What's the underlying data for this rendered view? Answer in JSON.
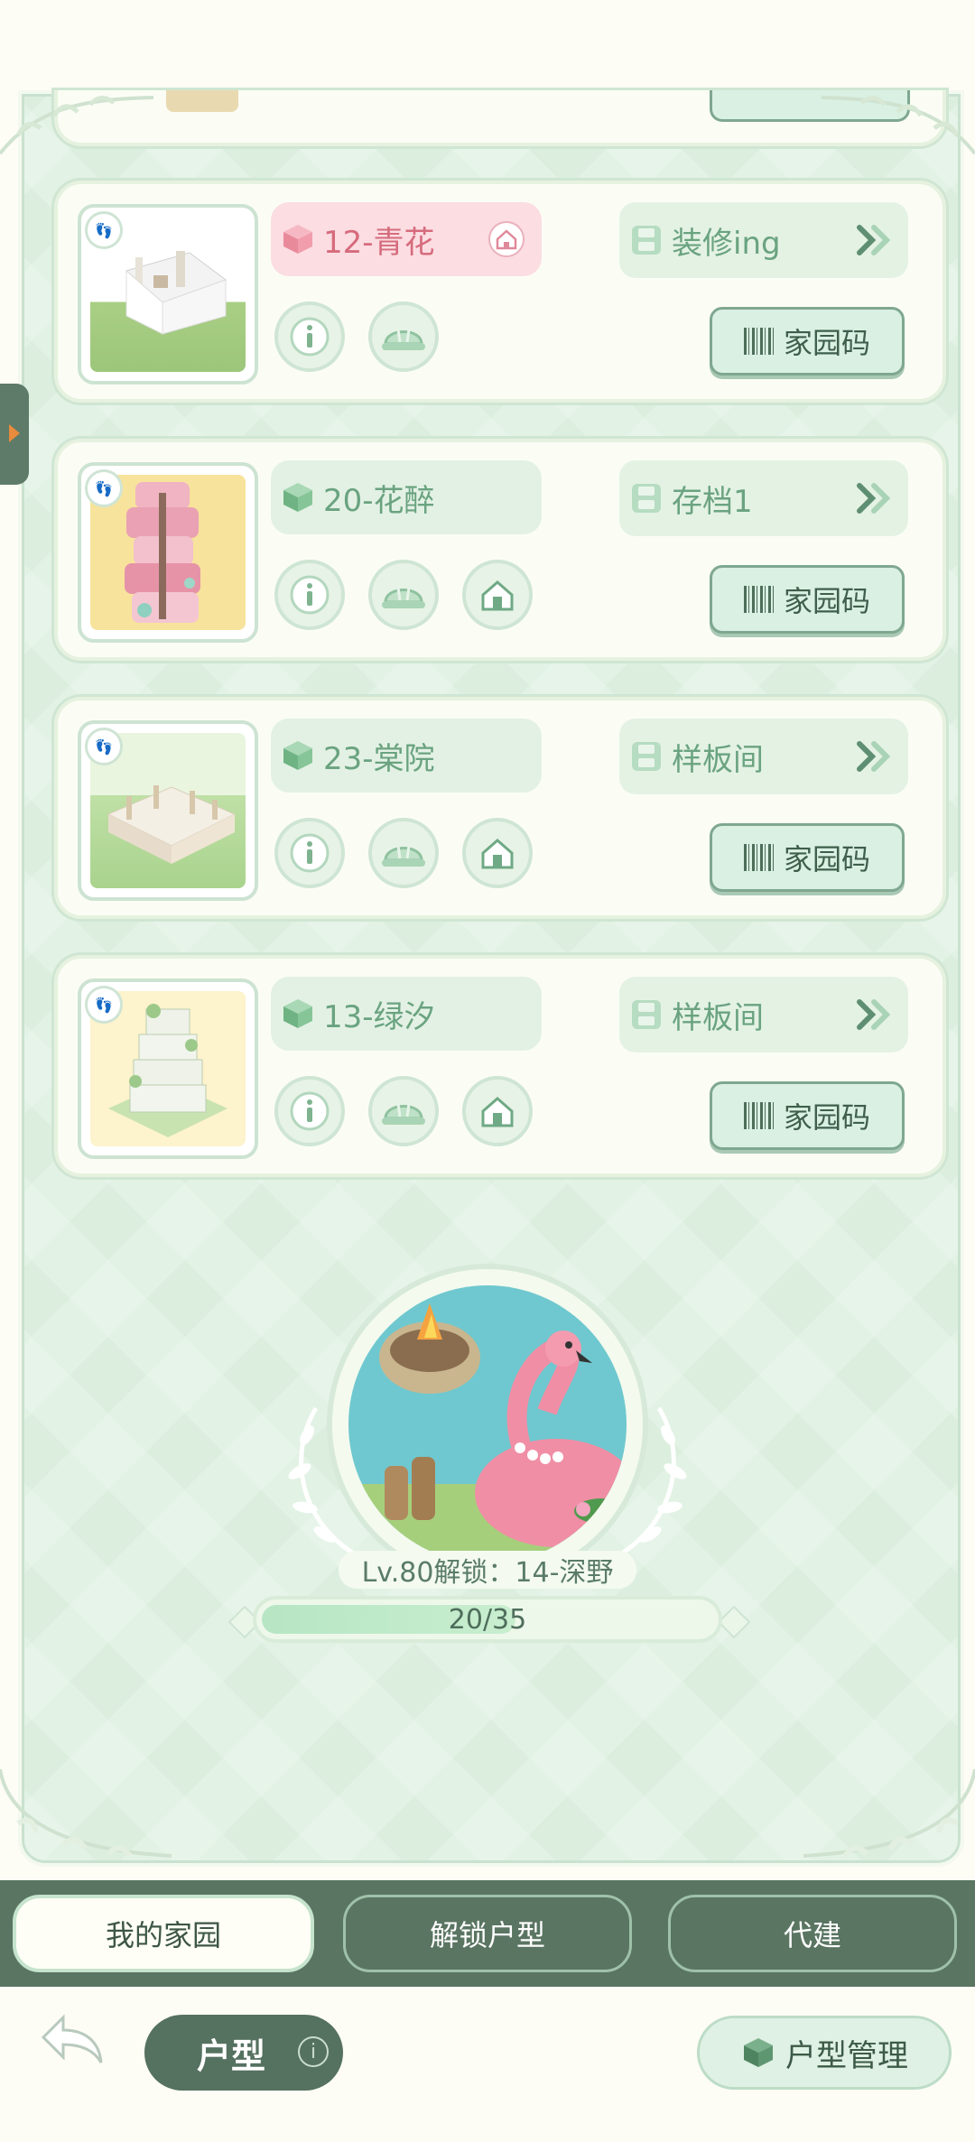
{
  "cards": [
    {
      "name": "12-青花",
      "slot": "装修ing",
      "code_label": "家园码",
      "active": true,
      "has_home_button": false
    },
    {
      "name": "20-花醉",
      "slot": "存档1",
      "code_label": "家园码",
      "active": false,
      "has_home_button": true
    },
    {
      "name": "23-棠院",
      "slot": "样板间",
      "code_label": "家园码",
      "active": false,
      "has_home_button": true
    },
    {
      "name": "13-绿汐",
      "slot": "样板间",
      "code_label": "家园码",
      "active": false,
      "has_home_button": true
    }
  ],
  "unlock": {
    "label": "Lv.80解锁：14-深野",
    "progress_text": "20/35",
    "progress_value": 20,
    "progress_max": 35
  },
  "tabs": {
    "my_home": "我的家园",
    "unlock_type": "解锁户型",
    "proxy_build": "代建"
  },
  "bottom": {
    "type_label": "户型",
    "manage_label": "户型管理"
  },
  "colors": {
    "panel_green": "#dcefdf",
    "tab_bar": "#5a7562",
    "active_pink": "#fbdde2",
    "accent_green": "#6aa380"
  }
}
